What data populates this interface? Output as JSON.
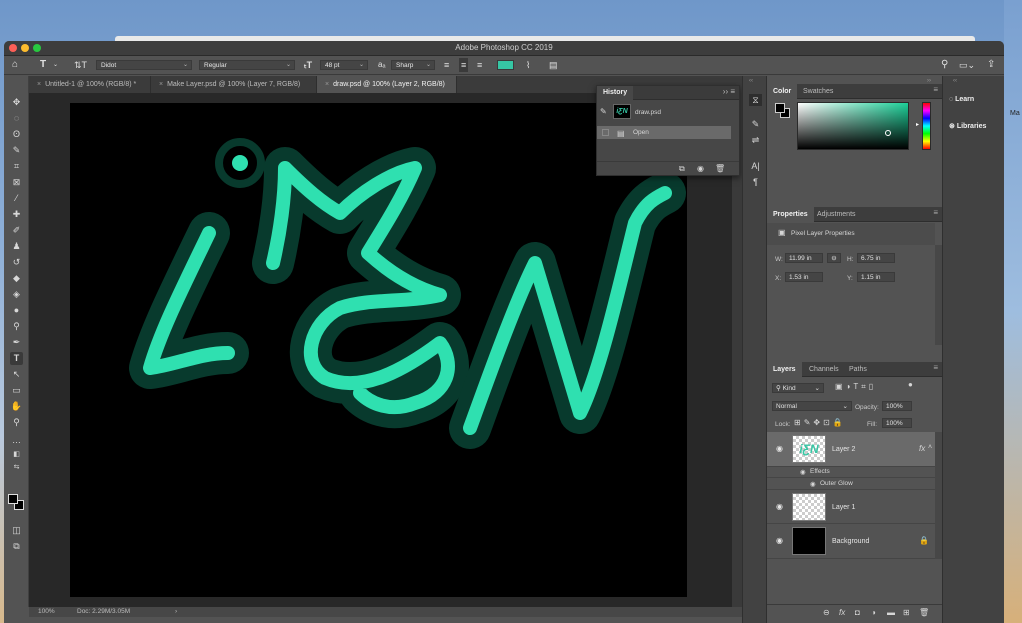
{
  "app": {
    "window_title": "Adobe Photoshop CC 2019"
  },
  "desktop": {
    "right_edge_text": "Ma"
  },
  "options_bar": {
    "font_family": "Didot",
    "font_style": "Regular",
    "font_size": "48 pt",
    "antialias_label": "a",
    "antialias": "Sharp",
    "text_color": "#36c6a4"
  },
  "tabs": [
    {
      "label": "Untitled-1 @ 100% (RGB/8) *"
    },
    {
      "label": "Make Layer.psd @ 100% (Layer 7, RGB/8)"
    },
    {
      "label": "draw.psd @ 100% (Layer 2, RGB/8)"
    }
  ],
  "canvas": {
    "stroke_color": "#2fe0b0",
    "glow_color": "#0f6a52"
  },
  "status": {
    "zoom": "100%",
    "doc": "Doc: 2.29M/3.05M",
    "arrow": "›"
  },
  "history": {
    "title": "History",
    "snapshot_name": "draw.psd",
    "thumb_text": "iƸN",
    "state_open": "Open"
  },
  "color_panel": {
    "tabs": [
      "Color",
      "Swatches"
    ]
  },
  "properties": {
    "tabs": [
      "Properties",
      "Adjustments"
    ],
    "header": "Pixel Layer Properties",
    "w_label": "W:",
    "w_value": "11.99 in",
    "h_label": "H:",
    "h_value": "6.75 in",
    "x_label": "X:",
    "x_value": "1.53 in",
    "y_label": "Y:",
    "y_value": "1.15 in",
    "link_icon": "⊖"
  },
  "layers_panel": {
    "tabs": [
      "Layers",
      "Channels",
      "Paths"
    ],
    "kind_label": "Kind",
    "blend_mode": "Normal",
    "opacity_label": "Opacity:",
    "opacity": "100%",
    "lock_label": "Lock:",
    "fill_label": "Fill:",
    "fill": "100%",
    "layers": [
      {
        "name": "Layer 2",
        "thumb_text": "iƸN",
        "fx": "fx"
      },
      {
        "name": "Layer 1"
      },
      {
        "name": "Background"
      }
    ],
    "effects_label": "Effects",
    "outer_glow_label": "Outer Glow",
    "footer_icons": [
      "link-icon",
      "fx",
      "mask-icon",
      "adjustment-icon",
      "folder-icon",
      "new-layer-icon",
      "trash-icon"
    ],
    "footer_fx": "fx"
  },
  "learn_panel": {
    "learn": "Learn",
    "libraries": "Libraries"
  }
}
